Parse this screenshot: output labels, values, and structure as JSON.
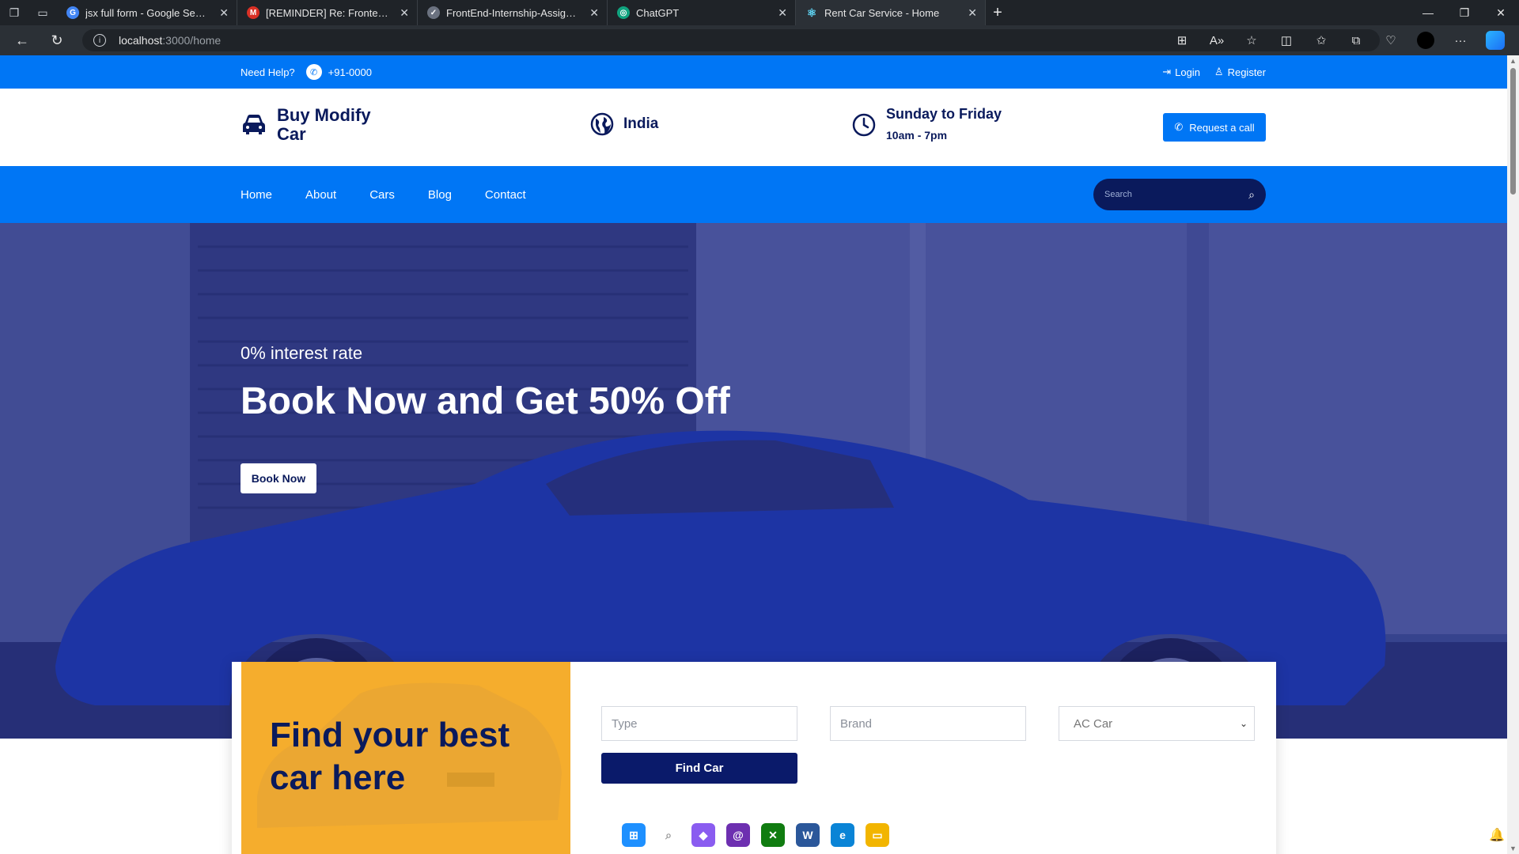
{
  "browser": {
    "tabs": [
      {
        "title": "jsx full form - Google Search",
        "icon": "google-icon",
        "color": "#4285f4",
        "glyph": "G"
      },
      {
        "title": "[REMINDER] Re: Frontend Devel...",
        "icon": "gmail-icon",
        "color": "#d93025",
        "glyph": "M"
      },
      {
        "title": "FrontEnd-Internship-Assignment",
        "icon": "doc-icon",
        "color": "#6b7280",
        "glyph": "✓"
      },
      {
        "title": "ChatGPT",
        "icon": "chatgpt-icon",
        "color": "#10a37f",
        "glyph": "◎"
      },
      {
        "title": "Rent Car Service - Home",
        "icon": "react-icon",
        "color": "#61dafb",
        "glyph": "⚛"
      }
    ],
    "new_tab": "+",
    "url_host": "localhost",
    "url_path": ":3000/home"
  },
  "topbar": {
    "need_help": "Need Help?",
    "phone": "+91-0000",
    "login": "Login",
    "register": "Register"
  },
  "header": {
    "brand": "Buy Modify Car",
    "location": "India",
    "hours_title": "Sunday to Friday",
    "hours_time": "10am - 7pm",
    "request_call": "Request a call"
  },
  "nav": {
    "items": [
      "Home",
      "About",
      "Cars",
      "Blog",
      "Contact"
    ],
    "search_placeholder": "Search"
  },
  "hero": {
    "subtitle": "0% interest rate",
    "title": "Book Now and Get 50% Off",
    "button": "Book Now"
  },
  "finder": {
    "promo_title": "Find your best car here",
    "type_placeholder": "Type",
    "brand_placeholder": "Brand",
    "ac_option": "AC Car",
    "find_button": "Find Car"
  },
  "colors": {
    "primary": "#0076f5",
    "navy": "#0a1a5c",
    "accent": "#f5ad2d"
  }
}
